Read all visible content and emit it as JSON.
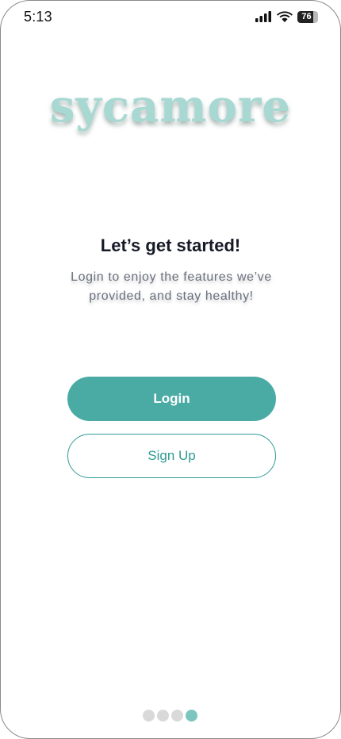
{
  "status_bar": {
    "time": "5:13",
    "battery_level": "76",
    "battery_fraction": 0.76,
    "icons": [
      "cellular-signal-icon",
      "wifi-icon",
      "battery-icon"
    ]
  },
  "logo": {
    "text": "sycamore"
  },
  "intro": {
    "title": "Let’s get started!",
    "subtitle": "Login to enjoy the features we’ve provided, and stay healthy!"
  },
  "actions": {
    "login_label": "Login",
    "signup_label": "Sign Up"
  },
  "pager": {
    "total": 4,
    "active_index": 3
  },
  "colors": {
    "accent": "#4aaba5",
    "accent_outline": "#2f9b94",
    "logo": "#a8d8d2",
    "dot_inactive": "#d9d9d9",
    "dot_active": "#7cc5bf"
  }
}
